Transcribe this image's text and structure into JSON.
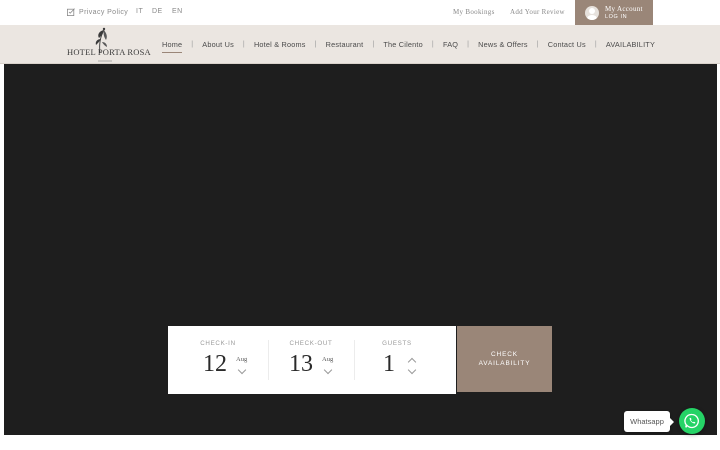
{
  "topbar": {
    "privacy_label": "Privacy Policy",
    "languages": [
      "IT",
      "DE",
      "EN"
    ],
    "my_bookings": "My Bookings",
    "add_review": "Add Your Review",
    "account_title": "My Account",
    "account_sub": "LOG IN"
  },
  "header": {
    "logo_text": "HOTEL PORTA ROSA"
  },
  "nav": {
    "items": [
      "Home",
      "About Us",
      "Hotel & Rooms",
      "Restaurant",
      "The Cilento",
      "FAQ",
      "News & Offers",
      "Contact Us",
      "AVAILABILITY"
    ],
    "separator": "|"
  },
  "booking": {
    "checkin_label": "CHECK-IN",
    "checkin_day": "12",
    "checkin_month": "Aug",
    "checkout_label": "CHECK-OUT",
    "checkout_day": "13",
    "checkout_month": "Aug",
    "guests_label": "GUESTS",
    "guests_value": "1",
    "check_button_line1": "CHECK",
    "check_button_line2": "AVAILABILITY"
  },
  "whatsapp": {
    "label": "Whatsapp"
  },
  "colors": {
    "accent": "#9a8678",
    "nav_bg": "#ebe6e1",
    "hero_bg": "#1e1e1e",
    "whatsapp": "#25d366"
  },
  "icons": [
    "checkbox-edit-icon",
    "user-avatar-icon",
    "logo-flower-icon",
    "chevron-down-icon",
    "chevron-up-icon",
    "whatsapp-icon"
  ]
}
